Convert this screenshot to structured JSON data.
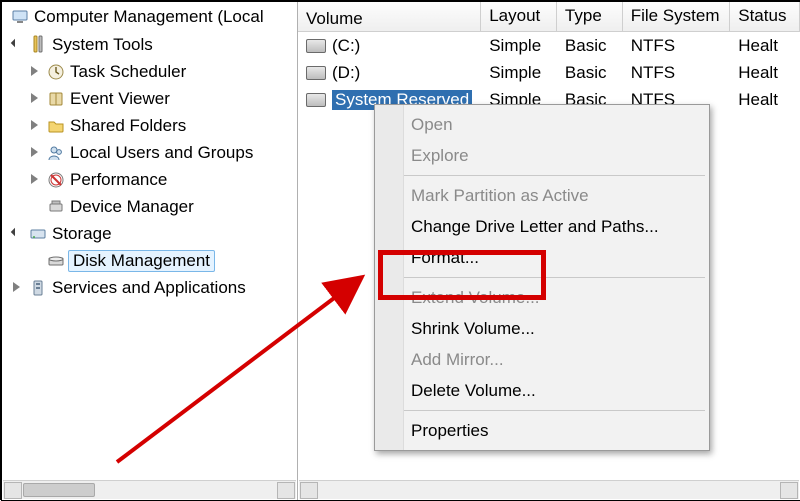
{
  "tree": {
    "root": "Computer Management (Local",
    "systemTools": {
      "label": "System Tools",
      "children": [
        "Task Scheduler",
        "Event Viewer",
        "Shared Folders",
        "Local Users and Groups",
        "Performance",
        "Device Manager"
      ]
    },
    "storage": {
      "label": "Storage",
      "children": [
        "Disk Management"
      ]
    },
    "services": "Services and Applications"
  },
  "columns": [
    "Volume",
    "Layout",
    "Type",
    "File System",
    "Status"
  ],
  "volumes": [
    {
      "name": "(C:)",
      "layout": "Simple",
      "type": "Basic",
      "fs": "NTFS",
      "status": "Healt"
    },
    {
      "name": "(D:)",
      "layout": "Simple",
      "type": "Basic",
      "fs": "NTFS",
      "status": "Healt"
    },
    {
      "name": "System Reserved",
      "layout": "Simple",
      "type": "Basic",
      "fs": "NTFS",
      "status": "Healt"
    }
  ],
  "contextMenu": [
    {
      "label": "Open",
      "enabled": false
    },
    {
      "label": "Explore",
      "enabled": false
    },
    {
      "sep": true
    },
    {
      "label": "Mark Partition as Active",
      "enabled": false
    },
    {
      "label": "Change Drive Letter and Paths...",
      "enabled": true
    },
    {
      "label": "Format...",
      "enabled": true,
      "highlight": true
    },
    {
      "sep": true
    },
    {
      "label": "Extend Volume...",
      "enabled": false
    },
    {
      "label": "Shrink Volume...",
      "enabled": true
    },
    {
      "label": "Add Mirror...",
      "enabled": false
    },
    {
      "label": "Delete Volume...",
      "enabled": true
    },
    {
      "sep": true
    },
    {
      "label": "Properties",
      "enabled": true
    }
  ]
}
